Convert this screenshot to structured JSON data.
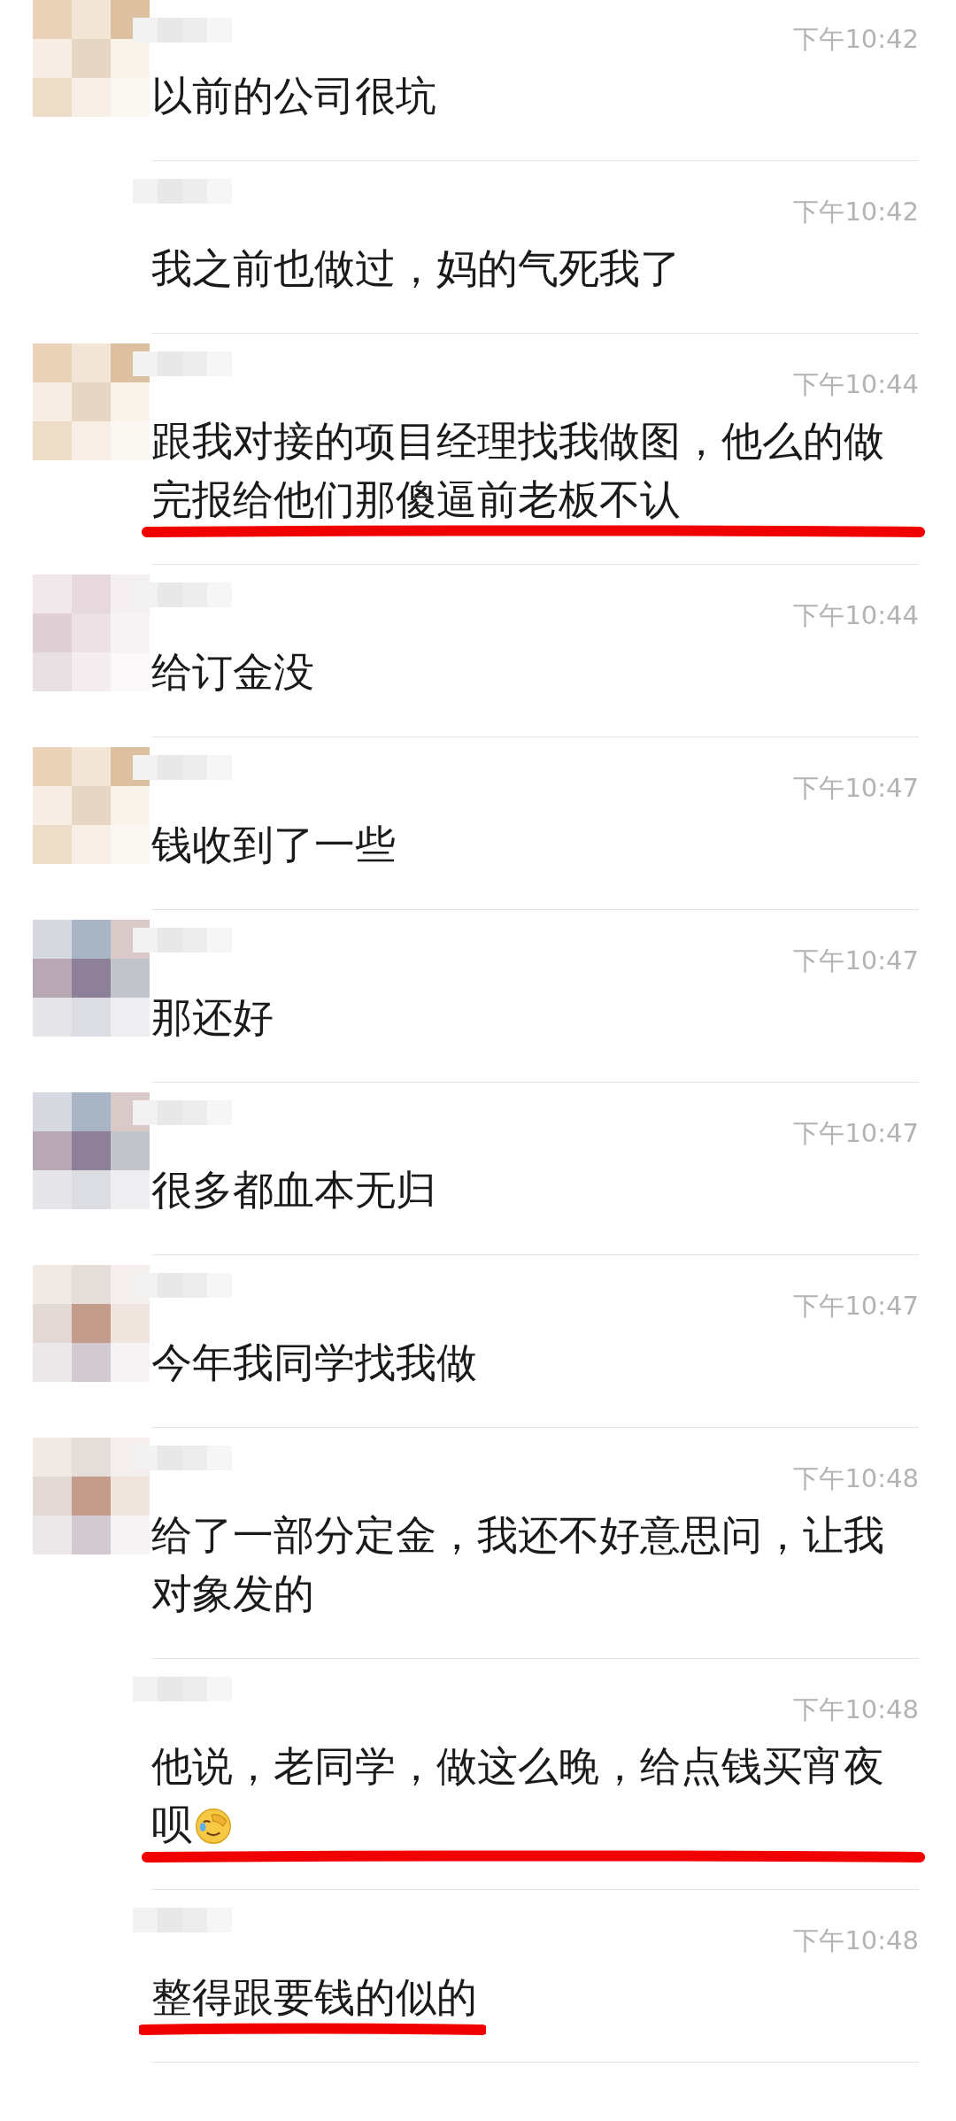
{
  "messages": [
    {
      "kind": "with_avatar",
      "time": "下午10:42",
      "text": "以前的公司很坑",
      "underlined": false
    },
    {
      "kind": "continuation",
      "time": "下午10:42",
      "text": "我之前也做过，妈的气死我了",
      "underlined": false
    },
    {
      "kind": "with_avatar",
      "time": "下午10:44",
      "text": "跟我对接的项目经理找我做图，他么的做完报给他们那傻逼前老板不认",
      "underlined": true
    },
    {
      "kind": "with_avatar",
      "time": "下午10:44",
      "text": "给订金没",
      "underlined": false
    },
    {
      "kind": "with_avatar",
      "time": "下午10:47",
      "text": "钱收到了一些",
      "underlined": false
    },
    {
      "kind": "with_avatar",
      "time": "下午10:47",
      "text": "那还好",
      "underlined": false
    },
    {
      "kind": "with_avatar",
      "time": "下午10:47",
      "text": "很多都血本无归",
      "underlined": false
    },
    {
      "kind": "with_avatar",
      "time": "下午10:47",
      "text": "今年我同学找我做",
      "underlined": false
    },
    {
      "kind": "with_avatar",
      "time": "下午10:48",
      "text": "给了一部分定金，我还不好意思问，让我对象发的",
      "underlined": false
    },
    {
      "kind": "continuation",
      "time": "下午10:48",
      "text": "他说，老同学，做这么晚，给点钱买宵夜呗",
      "trailing_emoji": true,
      "underlined": true
    },
    {
      "kind": "continuation",
      "time": "下午10:48",
      "text": "整得跟要钱的似的",
      "underlined": true
    }
  ]
}
